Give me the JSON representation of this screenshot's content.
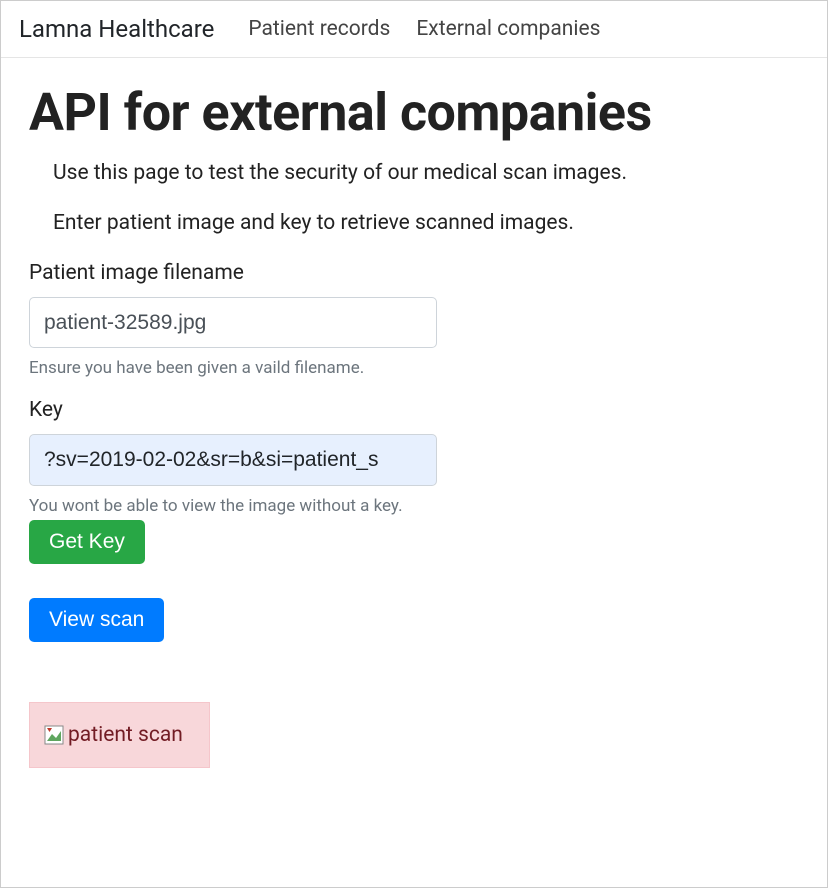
{
  "navbar": {
    "brand": "Lamna Healthcare",
    "links": [
      "Patient records",
      "External companies"
    ]
  },
  "page": {
    "title": "API for external companies",
    "intro1": "Use this page to test the security of our medical scan images.",
    "intro2": "Enter patient image and key to retrieve scanned images."
  },
  "form": {
    "filename_label": "Patient image filename",
    "filename_value": "patient-32589.jpg",
    "filename_help": "Ensure you have been given a vaild filename.",
    "key_label": "Key",
    "key_value": "?sv=2019-02-02&sr=b&si=patient_s",
    "key_help": "You wont be able to view the image without a key.",
    "getkey_button": "Get Key",
    "view_button": "View scan"
  },
  "result": {
    "alt_text": "patient scan"
  }
}
